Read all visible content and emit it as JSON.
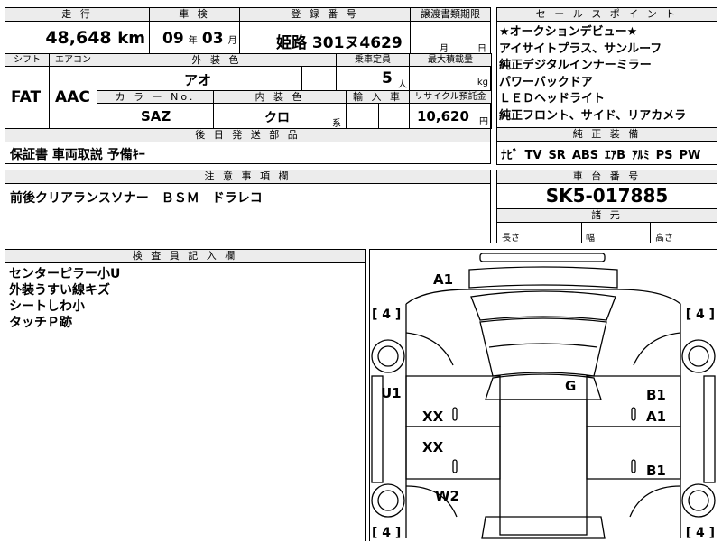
{
  "top": {
    "mileage_header": "走 行",
    "mileage_value": "48,648",
    "mileage_unit": "km",
    "inspection_header": "車 検",
    "inspection_year": "09",
    "inspection_year_unit": "年",
    "inspection_month": "03",
    "inspection_month_unit": "月",
    "registration_header": "登 録 番 号",
    "registration_value": "姫路 301ヌ4629",
    "transfer_header": "譲渡書類期限",
    "transfer_month_unit": "月",
    "transfer_day_unit": "日"
  },
  "row2": {
    "shift_header": "シフト",
    "shift_value": "FAT",
    "ac_header": "エアコン",
    "ac_value": "AAC",
    "exterior_color_header": "外 装 色",
    "exterior_color_value": "アオ",
    "capacity_header": "乗車定員",
    "capacity_value": "5",
    "capacity_unit": "人",
    "load_header": "最大積載量",
    "load_unit": "kg",
    "color_no_header": "カ ラ ー No.",
    "color_no_value": "SAZ",
    "interior_color_header": "内 装 色",
    "interior_color_value": "クロ",
    "interior_color_unit": "系",
    "import_header": "輸 入 車",
    "recycle_header": "リサイクル預託金",
    "recycle_value": "10,620",
    "recycle_unit": "円"
  },
  "accessories": {
    "header": "後 日 発 送 部 品",
    "value": "保証書 車両取説 予備ｷｰ"
  },
  "notes": {
    "header": "注 意 事 項 欄",
    "value": "前後クリアランスソナー　ＢＳＭ　ドラレコ"
  },
  "sales_points": {
    "header": "セ ー ル ス ポ イ ン ト",
    "lines": [
      "★オークションデビュー★",
      "アイサイトプラス、サンルーフ",
      "純正デジタルインナーミラー",
      "パワーバックドア",
      "ＬＥＤヘッドライト",
      "純正フロント、サイド、リアカメラ"
    ]
  },
  "equipment": {
    "header": "純 正 装 備",
    "items": [
      "ﾅﾋﾞ",
      "TV",
      "SR",
      "ABS",
      "ｴｱB",
      "ｱﾙﾐ",
      "PS",
      "PW"
    ]
  },
  "chassis": {
    "header": "車 台 番 号",
    "value": "SK5-017885"
  },
  "dimensions": {
    "header": "諸 元",
    "length_label": "長さ",
    "width_label": "幅",
    "height_label": "高さ"
  },
  "inspector": {
    "header": "検 査 員 記 入 欄",
    "lines": [
      "センターピラー小U",
      "外装うすい線キズ",
      "シートしわ小",
      "タッチＰ跡"
    ]
  },
  "diagram": {
    "tire_labels": [
      "[ 4 ]",
      "[ 4 ]",
      "[ 4 ]",
      "[ 4 ]"
    ],
    "marks": {
      "a1_top": "A1",
      "u1": "U1",
      "g": "G",
      "b1_upper": "B1",
      "a1_right": "A1",
      "xx_upper": "XX",
      "xx_lower": "XX",
      "b1_lower": "B1",
      "w2": "W2"
    }
  }
}
